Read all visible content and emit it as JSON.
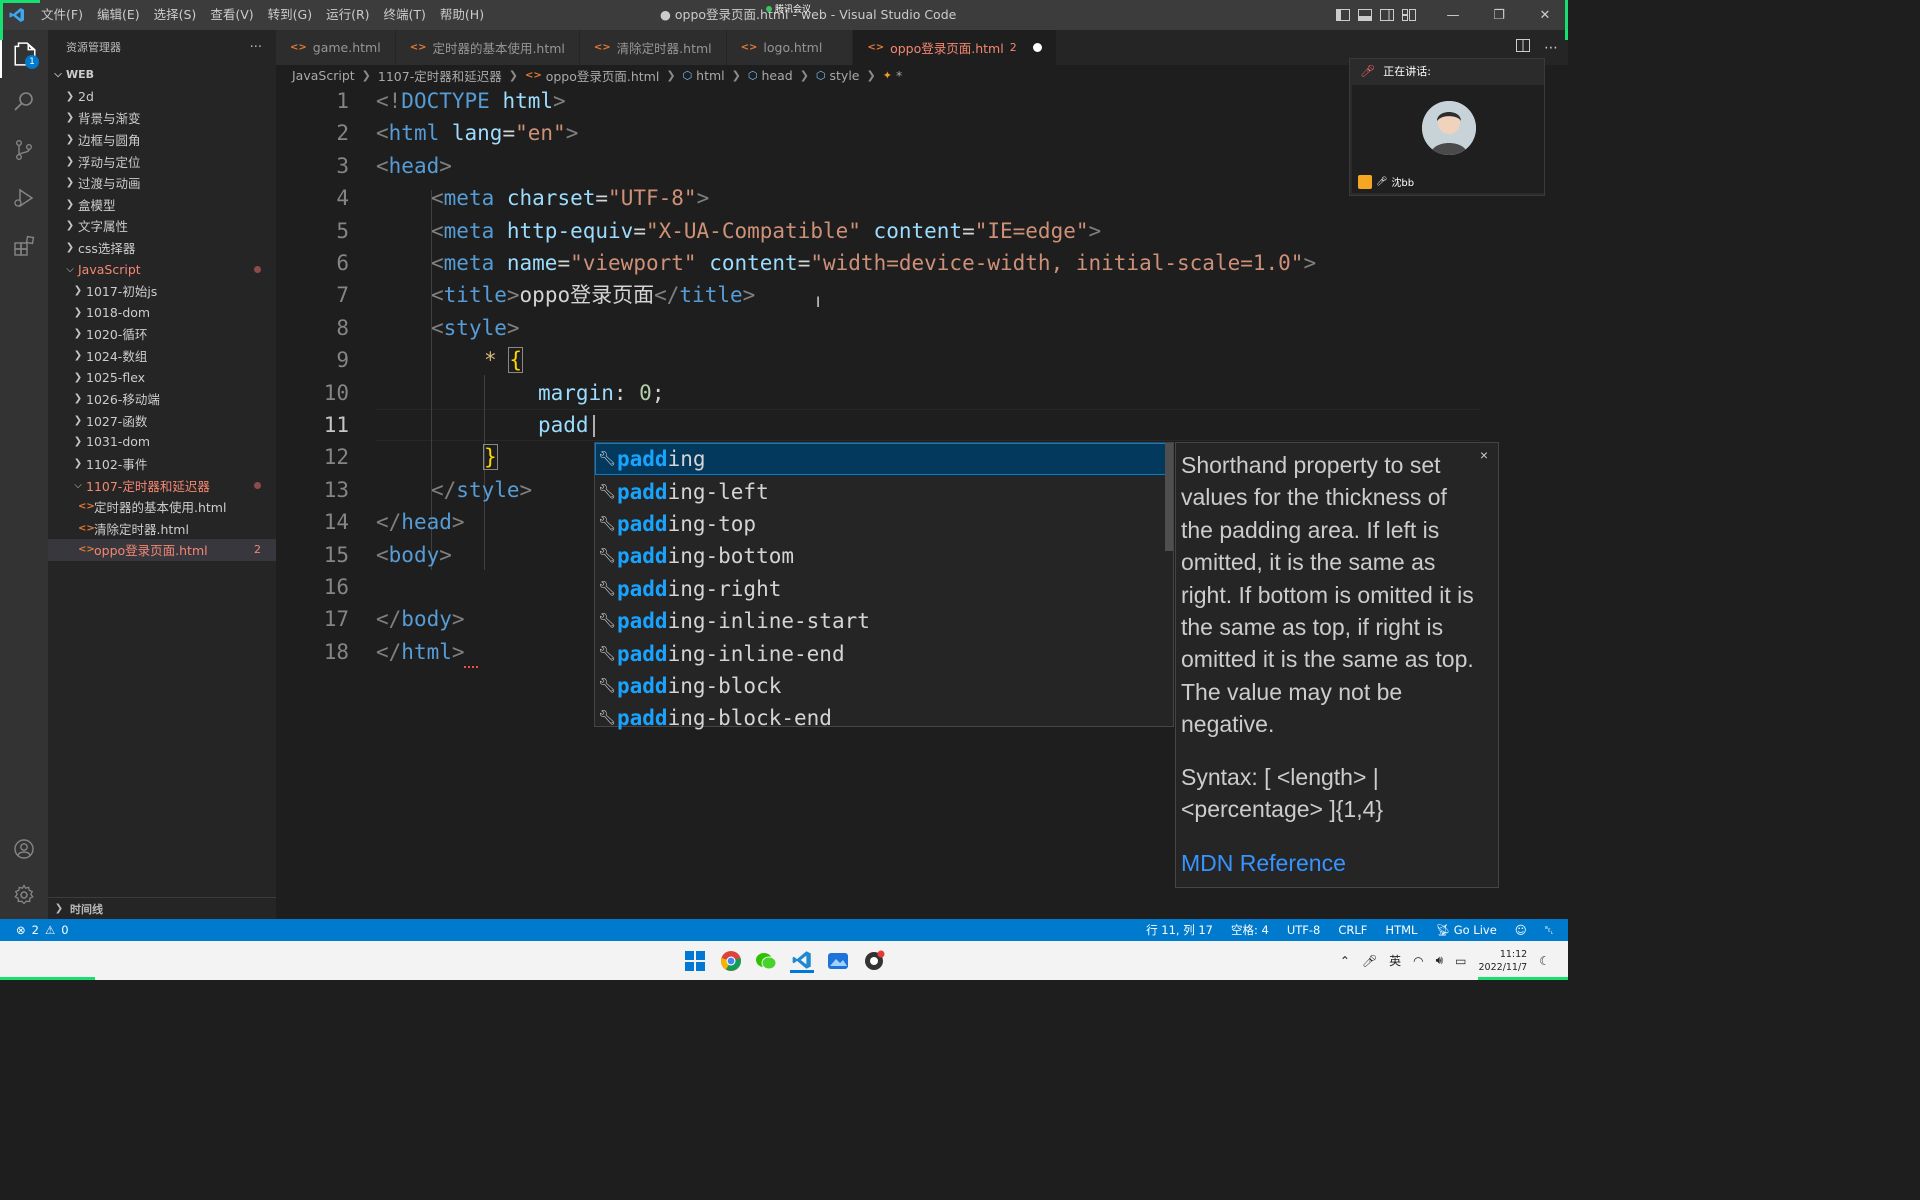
{
  "window": {
    "title": "● oppo登录页面.html - web - Visual Studio Code",
    "meeting_label": "腾讯会议",
    "menu": [
      "文件(F)",
      "编辑(E)",
      "选择(S)",
      "查看(V)",
      "转到(G)",
      "运行(R)",
      "终端(T)",
      "帮助(H)"
    ]
  },
  "activity": {
    "explorer_badge": "1"
  },
  "sidebar": {
    "header": "资源管理器",
    "more": "···",
    "root": "WEB",
    "folders": [
      "2d",
      "背景与渐变",
      "边框与圆角",
      "浮动与定位",
      "过渡与动画",
      "盒模型",
      "文字属性",
      "css选择器"
    ],
    "js_folder": "JavaScript",
    "js_children": [
      "1017-初始js",
      "1018-dom",
      "1020-循环",
      "1024-数组",
      "1025-flex",
      "1026-移动端",
      "1027-函数",
      "1031-dom",
      "1102-事件"
    ],
    "open_folder": "1107-定时器和延迟器",
    "files": [
      "定时器的基本使用.html",
      "清除定时器.html",
      "oppo登录页面.html"
    ],
    "active_file_problems": "2",
    "timeline": "时间线"
  },
  "tabs": [
    {
      "label": "game.html"
    },
    {
      "label": "定时器的基本使用.html"
    },
    {
      "label": "清除定时器.html"
    },
    {
      "label": "logo.html"
    },
    {
      "label": "oppo登录页面.html",
      "problems": "2"
    }
  ],
  "breadcrumb": [
    "JavaScript",
    "1107-定时器和延迟器",
    "oppo登录页面.html",
    "html",
    "head",
    "style",
    "*"
  ],
  "editor": {
    "line_numbers": [
      "1",
      "2",
      "3",
      "4",
      "5",
      "6",
      "7",
      "8",
      "9",
      "10",
      "11",
      "12",
      "13",
      "14",
      "15",
      "16",
      "17",
      "18"
    ],
    "current_line": 11,
    "l1": [
      "<!",
      "DOCTYPE",
      " html",
      ">"
    ],
    "l2": [
      "<",
      "html",
      " lang",
      "=",
      "\"en\"",
      ">"
    ],
    "l3": [
      "<",
      "head",
      ">"
    ],
    "l4": [
      "<",
      "meta",
      " charset",
      "=",
      "\"UTF-8\"",
      ">"
    ],
    "l5": [
      "<",
      "meta",
      " http-equiv",
      "=",
      "\"X-UA-Compatible\"",
      " content",
      "=",
      "\"IE=edge\"",
      ">"
    ],
    "l6": [
      "<",
      "meta",
      " name",
      "=",
      "\"viewport\"",
      " content",
      "=",
      "\"width=device-width, initial-scale=1.0\"",
      ">"
    ],
    "l7": [
      "<",
      "title",
      ">",
      "oppo登录页面",
      "</",
      "title",
      ">"
    ],
    "l8": [
      "<",
      "style",
      ">"
    ],
    "l9": [
      "*",
      " ",
      "{"
    ],
    "l10": [
      "margin",
      ": ",
      "0",
      ";"
    ],
    "l11": [
      "padd"
    ],
    "l12": [
      "}"
    ],
    "l13": [
      "</",
      "style",
      ">"
    ],
    "l14": [
      "</",
      "head",
      ">"
    ],
    "l15": [
      "<",
      "body",
      ">"
    ],
    "l17": [
      "</",
      "body",
      ">"
    ],
    "l18": [
      "</",
      "html",
      ">"
    ]
  },
  "suggest": {
    "match": "padd",
    "items": [
      {
        "rest": "ing"
      },
      {
        "rest": "ing-left"
      },
      {
        "rest": "ing-top"
      },
      {
        "rest": "ing-bottom"
      },
      {
        "rest": "ing-right"
      },
      {
        "rest": "ing-inline-start"
      },
      {
        "rest": "ing-inline-end"
      },
      {
        "rest": "ing-block"
      },
      {
        "rest": "ing-block-end"
      }
    ],
    "details": {
      "close": "×",
      "description": "Shorthand property to set values for the thickness of the padding area. If left is omitted, it is the same as right. If bottom is omitted it is the same as top, if right is omitted it is the same as top. The value may not be negative.",
      "syntax": "Syntax: [ <length> | <percentage> ]{1,4}",
      "reference": "MDN Reference"
    }
  },
  "meeting": {
    "speaking_label": "正在讲话:",
    "participant": "沈bb"
  },
  "statusbar": {
    "errors": "2",
    "warnings": "0",
    "position": "行 11, 列 17",
    "spaces": "空格: 4",
    "encoding": "UTF-8",
    "eol": "CRLF",
    "language": "HTML",
    "golive": "Go Live"
  },
  "taskbar": {
    "ime": "英",
    "time": "11:12",
    "date": "2022/11/7"
  }
}
